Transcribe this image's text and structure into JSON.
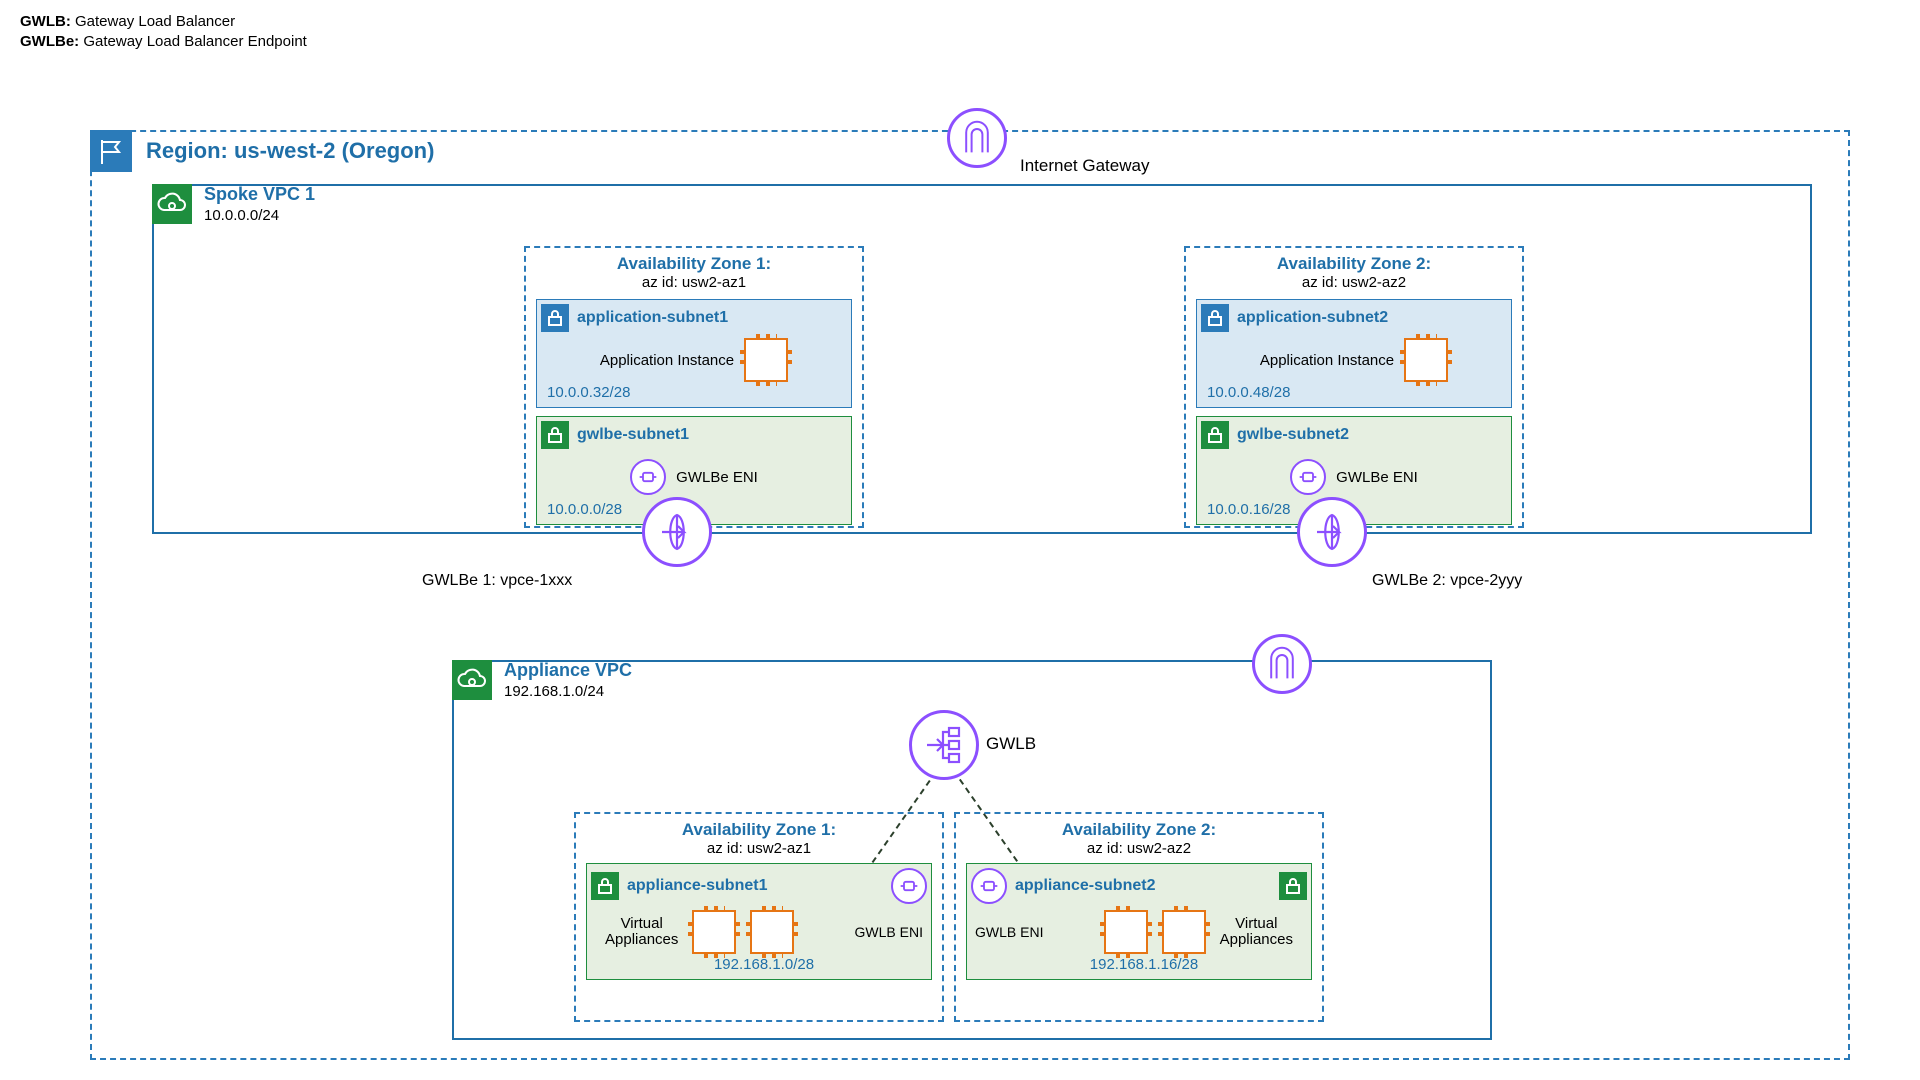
{
  "legend": {
    "k1": "GWLB:",
    "v1": "Gateway Load Balancer",
    "k2": "GWLBe:",
    "v2": "Gateway Load Balancer Endpoint"
  },
  "region": {
    "title": "Region: us-west-2 (Oregon)"
  },
  "igw_text": "Internet Gateway",
  "spoke": {
    "title": "Spoke VPC 1",
    "cidr": "10.0.0.0/24",
    "az1": {
      "title": "Availability Zone 1:",
      "id": "az id: usw2-az1"
    },
    "az2": {
      "title": "Availability Zone 2:",
      "id": "az id: usw2-az2"
    },
    "app1": {
      "name": "application-subnet1",
      "label": "Application Instance",
      "cidr": "10.0.0.32/28"
    },
    "app2": {
      "name": "application-subnet2",
      "label": "Application Instance",
      "cidr": "10.0.0.48/28"
    },
    "gwlbe1": {
      "name": "gwlbe-subnet1",
      "eni": "GWLBe ENI",
      "cidr": "10.0.0.0/28"
    },
    "gwlbe2": {
      "name": "gwlbe-subnet2",
      "eni": "GWLBe ENI",
      "cidr": "10.0.0.16/28"
    },
    "ep1": "GWLBe 1: vpce-1xxx",
    "ep2": "GWLBe 2: vpce-2yyy"
  },
  "appliance": {
    "title": "Appliance VPC",
    "cidr": "192.168.1.0/24",
    "gwlb": "GWLB",
    "az1": {
      "title": "Availability Zone 1:",
      "id": "az id: usw2-az1"
    },
    "az2": {
      "title": "Availability Zone 2:",
      "id": "az id: usw2-az2"
    },
    "sub1": {
      "name": "appliance-subnet1",
      "eni": "GWLB ENI",
      "va": "Virtual\nAppliances",
      "cidr": "192.168.1.0/28"
    },
    "sub2": {
      "name": "appliance-subnet2",
      "eni": "GWLB ENI",
      "va": "Virtual\nAppliances",
      "cidr": "192.168.1.16/28"
    }
  }
}
